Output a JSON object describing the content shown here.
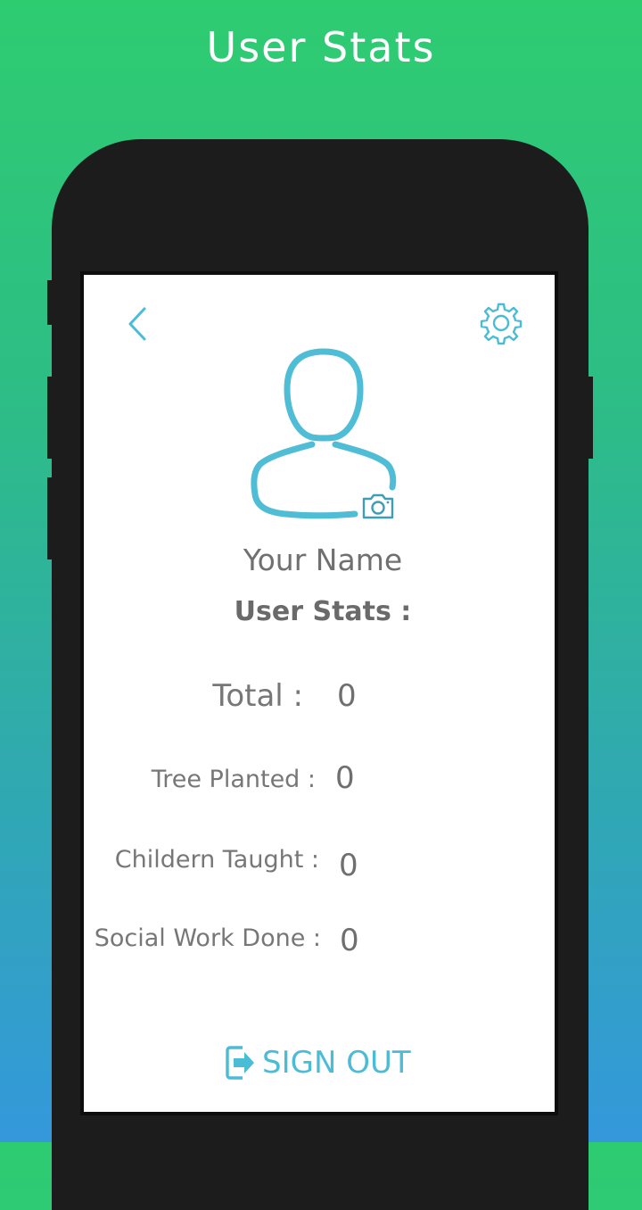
{
  "header": {
    "title": "User Stats"
  },
  "profile": {
    "name": "Your Name",
    "stats_heading": "User Stats :"
  },
  "stats": [
    {
      "label": "Total :",
      "value": "0"
    },
    {
      "label": "Tree Planted :",
      "value": "0"
    },
    {
      "label": "Childern Taught :",
      "value": "0"
    },
    {
      "label": "Social Work Done :",
      "value": "0"
    }
  ],
  "actions": {
    "sign_out": "SIGN OUT"
  },
  "icons": {
    "back": "chevron-left-icon",
    "settings": "gear-icon",
    "avatar": "user-outline-icon",
    "camera": "camera-icon",
    "sign_out": "exit-icon"
  },
  "colors": {
    "accent": "#4bbcd6",
    "gradient_top": "#2ecc71",
    "gradient_bottom": "#3498db",
    "phone_body": "#1c1c1c",
    "text_gray": "#707070"
  }
}
